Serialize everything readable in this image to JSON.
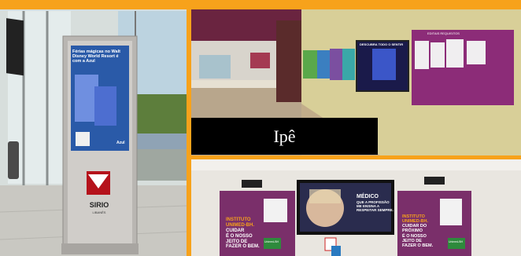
{
  "top_banner": {
    "color": "#f7a21b"
  },
  "kiosk": {
    "ad_text": "Férias mágicas no Walt Disney World Resort é com a Azul",
    "ad_brand": "Azul",
    "logo_text": "SIRIO",
    "logo_sub": "LIBANÊS"
  },
  "lobby": {
    "caption": "Ipê",
    "board_header": "EDITAIS REQUISITOS",
    "poster_text": "DESCUBRA TODO O SENTIR"
  },
  "elevators": {
    "left_sign": [
      "INSTITUTO",
      "UNIMED-BH.",
      "CUIDAR",
      "É O NOSSO",
      "JEITO DE",
      "FAZER O BEM."
    ],
    "right_sign": [
      "INSTITUTO",
      "UNIMED-BH.",
      "CUIDAR DO",
      "PRÓXIMO",
      "É O NOSSO",
      "JEITO DE",
      "FAZER O BEM."
    ],
    "screen_text": [
      "MÉDICO",
      "QUE A PROFISSÃO",
      "ME ENSINA A",
      "RESPEITAR SEMPRE."
    ],
    "brand": "Unimed-BH"
  }
}
